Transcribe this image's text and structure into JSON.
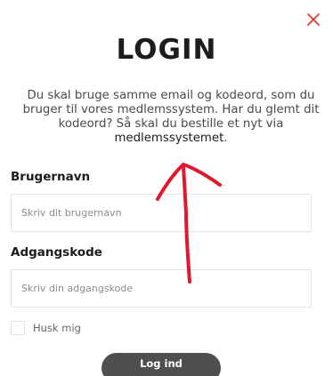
{
  "colors": {
    "close_icon": "#e23b2a",
    "annotation_arrow": "#e0182d",
    "button_bg": "#4f4f4f",
    "button_text": "#ffffff",
    "title_text": "#1c1c1c"
  },
  "header": {
    "close_icon": "close-icon",
    "title": "LOGIN"
  },
  "intro": {
    "text_before_link": "Du skal bruge samme email og kodeord, som du bruger til vores medlemssystem. Har du glemt dit kodeord? Så skal du bestille et nyt via ",
    "link_text": "medlemssystemet",
    "text_after_link": "."
  },
  "form": {
    "username": {
      "label": "Brugernavn",
      "placeholder": "Skriv dit brugernavn",
      "value": ""
    },
    "password": {
      "label": "Adgangskode",
      "placeholder": "Skriv din adgangskode",
      "value": ""
    },
    "remember": {
      "label": "Husk mig",
      "checked": false
    },
    "submit_label": "Log ind"
  }
}
